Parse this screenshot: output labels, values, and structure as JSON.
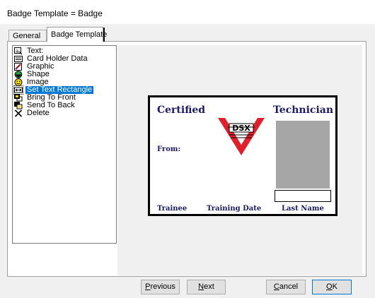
{
  "window": {
    "title": "Badge Template = Badge"
  },
  "tabs": [
    {
      "label": "General"
    },
    {
      "label": "Badge Template"
    }
  ],
  "tools": [
    {
      "label": "Text:",
      "icon": "text-tool-icon"
    },
    {
      "label": "Card Holder Data",
      "icon": "card-holder-icon"
    },
    {
      "label": "Graphic",
      "icon": "graphic-icon"
    },
    {
      "label": "Shape",
      "icon": "shape-icon"
    },
    {
      "label": "Image",
      "icon": "smiley-image-icon"
    },
    {
      "label": "Set Text Rectangle",
      "icon": "text-rectangle-icon",
      "selected": true
    },
    {
      "label": "Bring To Front",
      "icon": "bring-to-front-icon"
    },
    {
      "label": "Send To Back",
      "icon": "send-to-back-icon"
    },
    {
      "label": "Delete",
      "icon": "delete-x-icon"
    }
  ],
  "badge": {
    "certified": "Certified",
    "technician": "Technician",
    "from": "From:",
    "trainee": "Trainee",
    "training_date": "Training Date",
    "last_name": "Last Name",
    "logo_text": "DSX",
    "text_color": "#1a1a66",
    "logo_color": "#e0202a",
    "photo_color": "#a6a6a6"
  },
  "buttons": {
    "previous": {
      "mnemonic": "P",
      "rest": "revious"
    },
    "next": {
      "mnemonic": "N",
      "rest": "ext"
    },
    "cancel": {
      "mnemonic": "C",
      "rest": "ancel"
    },
    "ok": {
      "mnemonic": "O",
      "rest": "K"
    }
  }
}
